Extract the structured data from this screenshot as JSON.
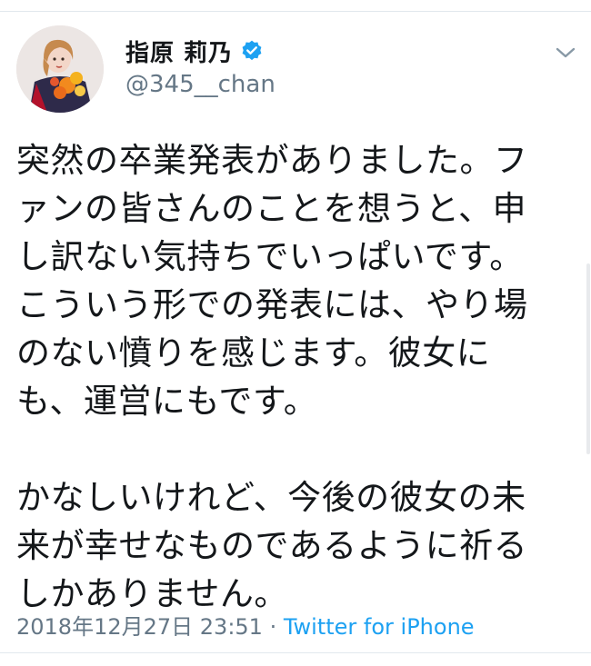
{
  "tweet": {
    "author": {
      "display_name": "指原 莉乃",
      "handle": "@345__chan",
      "verified": true,
      "avatar_icon": "profile-photo-avatar"
    },
    "menu_icon": "chevron-down-icon",
    "text_lines": [
      "突然の卒業発表がありました。フ",
      "ァンの皆さんのことを想うと、申",
      "し訳ない気持ちでいっぱいです。",
      "こういう形での発表には、やり場",
      "のない憤りを感じます。彼女に",
      "も、運営にもです。",
      "",
      "かなしいけれど、今後の彼女の未",
      "来が幸せなものであるように祈る",
      "しかありません。"
    ],
    "timestamp": "2018年12月27日 23:51",
    "separator": " · ",
    "source": "Twitter for iPhone"
  },
  "colors": {
    "text": "#14171a",
    "secondary": "#657786",
    "link": "#1da1f2",
    "verified_badge": "#1da1f2",
    "divider": "#e1e8ed"
  }
}
